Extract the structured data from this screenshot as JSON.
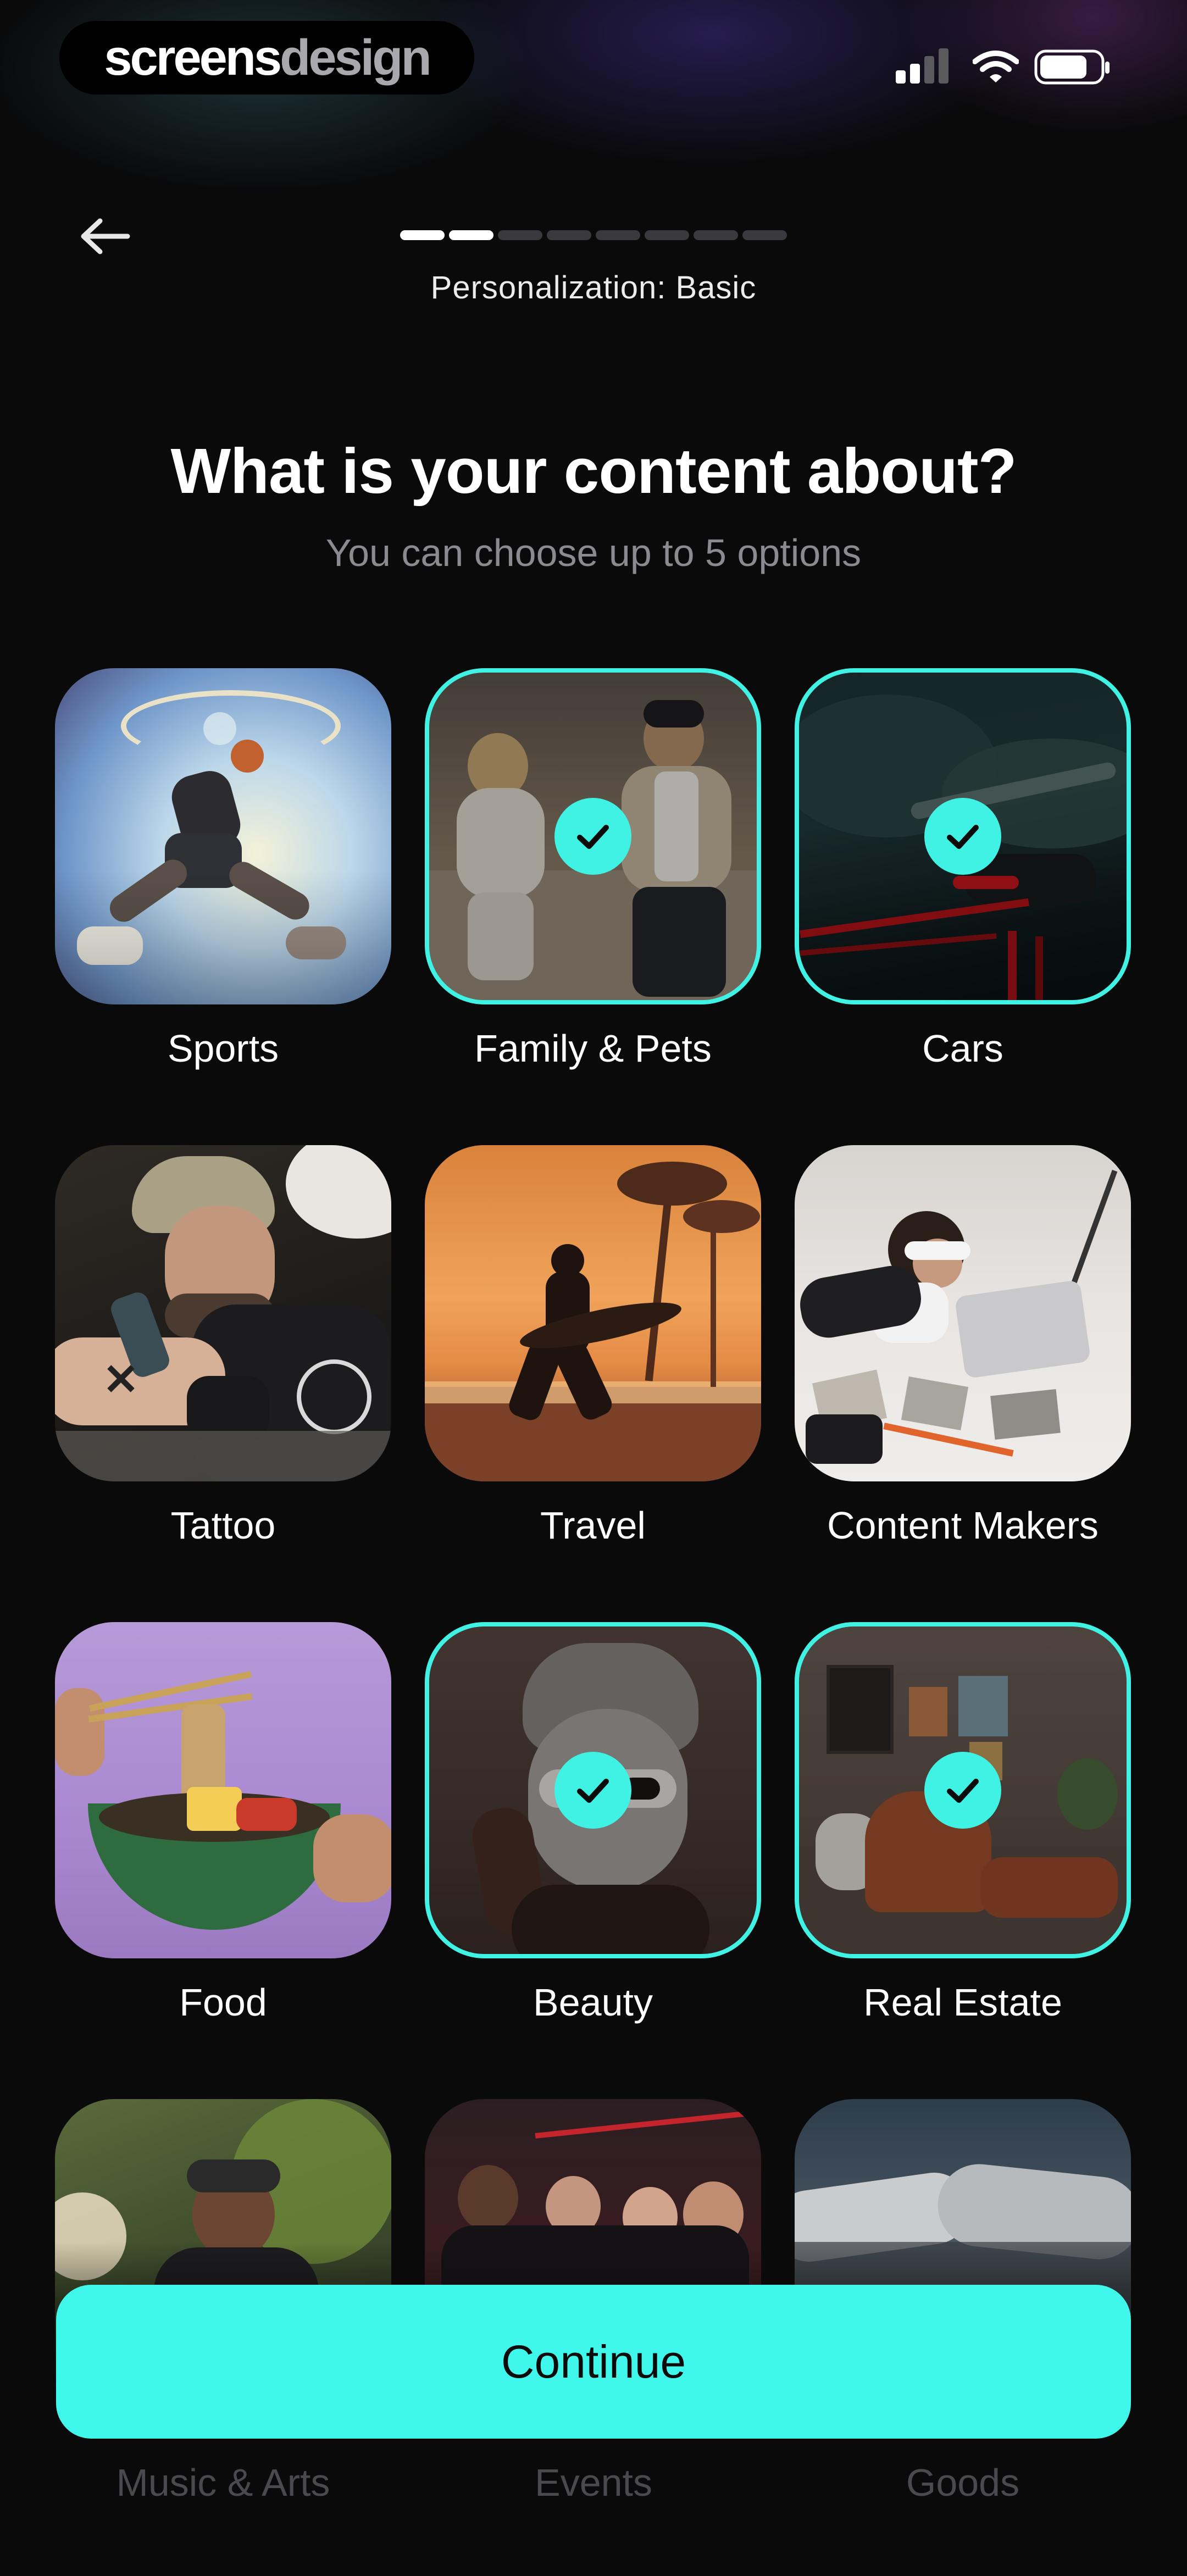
{
  "status_bar": {
    "brand_primary": "screens",
    "brand_secondary": "design",
    "signal_icon": "cellular-signal-icon",
    "wifi_icon": "wifi-icon",
    "battery_icon": "battery-icon"
  },
  "nav": {
    "back_icon": "arrow-left-icon",
    "progress": {
      "total_steps": 8,
      "completed_steps": 2
    },
    "step_label": "Personalization: Basic"
  },
  "header": {
    "title": "What is your content about?",
    "subtitle": "You can choose up to 5 options"
  },
  "options": [
    {
      "label": "Sports",
      "selected": false
    },
    {
      "label": "Family & Pets",
      "selected": true
    },
    {
      "label": "Cars",
      "selected": true
    },
    {
      "label": "Tattoo",
      "selected": false
    },
    {
      "label": "Travel",
      "selected": false
    },
    {
      "label": "Content Makers",
      "selected": false
    },
    {
      "label": "Food",
      "selected": false
    },
    {
      "label": "Beauty",
      "selected": true
    },
    {
      "label": "Real Estate",
      "selected": true
    },
    {
      "label": "Music & Arts",
      "selected": false
    },
    {
      "label": "Events",
      "selected": false
    },
    {
      "label": "Goods",
      "selected": false
    }
  ],
  "footer": {
    "continue_label": "Continue"
  },
  "colors": {
    "accent": "#3ff7ea",
    "background": "#0a0a0b",
    "muted_text": "#8a8a8f"
  }
}
